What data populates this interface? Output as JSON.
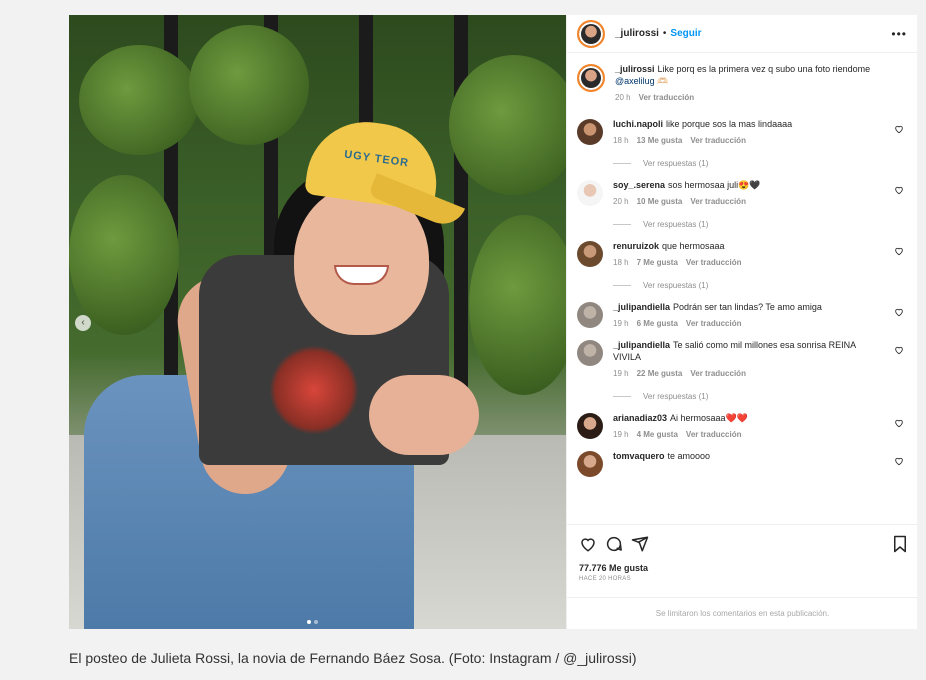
{
  "post": {
    "username": "_julirossi",
    "separator": "•",
    "follow_label": "Seguir",
    "more_label": "•••",
    "image_alt": "Foto del posteo de _julirossi",
    "cap_print": "UGY TEOR"
  },
  "caption": {
    "username": "_julirossi",
    "text": "Like porq es la primera vez q subo una foto riendome",
    "mention": "@axelilug",
    "emoji": "🫶🏻",
    "time": "20 h",
    "translate": "Ver traducción"
  },
  "comments": [
    {
      "username": "luchi.napoli",
      "text": "like porque sos la mas lindaaaa",
      "time": "18 h",
      "likes": "13 Me gusta",
      "translate": "Ver traducción",
      "replies": "Ver respuestas (1)"
    },
    {
      "username": "soy_.serena",
      "text": "sos hermosaa juli😍🖤",
      "time": "20 h",
      "likes": "10 Me gusta",
      "translate": "Ver traducción",
      "replies": "Ver respuestas (1)"
    },
    {
      "username": "renuruizok",
      "text": "que hermosaaa",
      "time": "18 h",
      "likes": "7 Me gusta",
      "translate": "Ver traducción",
      "replies": "Ver respuestas (1)"
    },
    {
      "username": "_julipandiella",
      "text": "Podrán ser tan lindas? Te amo amiga",
      "time": "19 h",
      "likes": "6 Me gusta",
      "translate": "Ver traducción"
    },
    {
      "username": "_julipandiella",
      "text": "Te salió como mil millones esa sonrisa REINA VIVILA",
      "time": "19 h",
      "likes": "22 Me gusta",
      "translate": "Ver traducción",
      "replies": "Ver respuestas (1)"
    },
    {
      "username": "arianadiaz03",
      "text": "Ai hermosaaa❤️❤️",
      "time": "19 h",
      "likes": "4 Me gusta",
      "translate": "Ver traducción"
    },
    {
      "username": "tomvaquero",
      "text": "te amoooo"
    }
  ],
  "footer": {
    "likes": "77.776 Me gusta",
    "ago": "HACE 20 HORAS",
    "limited": "Se limitaron los comentarios en esta publicación."
  },
  "figure_caption": "El posteo de Julieta Rossi, la novia de Fernando Báez Sosa. (Foto: Instagram / @_julirossi)",
  "colors": {
    "link": "#0095f6",
    "muted": "#8e8e8e",
    "text": "#262626"
  },
  "icons": [
    "chevron-left-icon",
    "more-icon",
    "heart-icon",
    "comment-icon",
    "share-icon",
    "bookmark-icon"
  ]
}
